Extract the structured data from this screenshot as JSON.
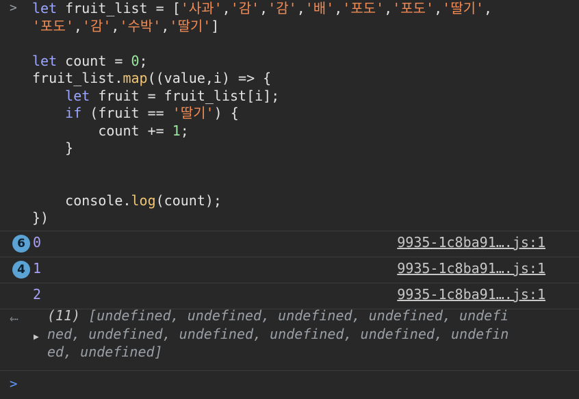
{
  "input": {
    "prompt": ">",
    "code_lines": [
      [
        [
          "kw",
          "let"
        ],
        [
          "p",
          " fruit_list = ["
        ],
        [
          "str",
          "'사과'"
        ],
        [
          "p",
          ","
        ],
        [
          "str",
          "'감'"
        ],
        [
          "p",
          ","
        ],
        [
          "str",
          "'감'"
        ],
        [
          "p",
          ","
        ],
        [
          "str",
          "'배'"
        ],
        [
          "p",
          ","
        ],
        [
          "str",
          "'포도'"
        ],
        [
          "p",
          ","
        ],
        [
          "str",
          "'포도'"
        ],
        [
          "p",
          ","
        ],
        [
          "str",
          "'딸기'"
        ],
        [
          "p",
          ","
        ]
      ],
      [
        [
          "str",
          "'포도'"
        ],
        [
          "p",
          ","
        ],
        [
          "str",
          "'감'"
        ],
        [
          "p",
          ","
        ],
        [
          "str",
          "'수박'"
        ],
        [
          "p",
          ","
        ],
        [
          "str",
          "'딸기'"
        ],
        [
          "p",
          "]"
        ]
      ],
      [],
      [
        [
          "kw",
          "let"
        ],
        [
          "p",
          " count = "
        ],
        [
          "num",
          "0"
        ],
        [
          "p",
          ";"
        ]
      ],
      [
        [
          "p",
          "fruit_list."
        ],
        [
          "fn",
          "map"
        ],
        [
          "p",
          "((value,i) => {"
        ]
      ],
      [
        [
          "p",
          "    "
        ],
        [
          "kw",
          "let"
        ],
        [
          "p",
          " fruit = fruit_list[i];"
        ]
      ],
      [
        [
          "p",
          "    "
        ],
        [
          "kw",
          "if"
        ],
        [
          "p",
          " (fruit == "
        ],
        [
          "str",
          "'딸기'"
        ],
        [
          "p",
          ") {"
        ]
      ],
      [
        [
          "p",
          "        count += "
        ],
        [
          "num",
          "1"
        ],
        [
          "p",
          ";"
        ]
      ],
      [
        [
          "p",
          "    }"
        ]
      ],
      [],
      [],
      [
        [
          "p",
          "    console."
        ],
        [
          "fn",
          "log"
        ],
        [
          "p",
          "(count);"
        ]
      ],
      [
        [
          "p",
          "})"
        ]
      ]
    ]
  },
  "logs": [
    {
      "badge": "6",
      "value": "0",
      "source": "9935-1c8ba91….js:1"
    },
    {
      "badge": "4",
      "value": "1",
      "source": "9935-1c8ba91….js:1"
    },
    {
      "badge": "",
      "value": "2",
      "source": "9935-1c8ba91….js:1"
    }
  ],
  "result": {
    "return_icon": "⬸",
    "expand_icon": "▶",
    "count_label": "(11)",
    "line1": " [undefined, undefined, undefined, undefined, undefi",
    "line2": "ned, undefined, undefined, undefined, undefined, undefin",
    "line3": "ed, undefined]"
  },
  "caret": ">",
  "colors": {
    "background": "#282828",
    "keyword": "#9aa6ff",
    "string": "#f28b54",
    "number": "#9ce5a0",
    "badge": "#5ba3d4"
  }
}
